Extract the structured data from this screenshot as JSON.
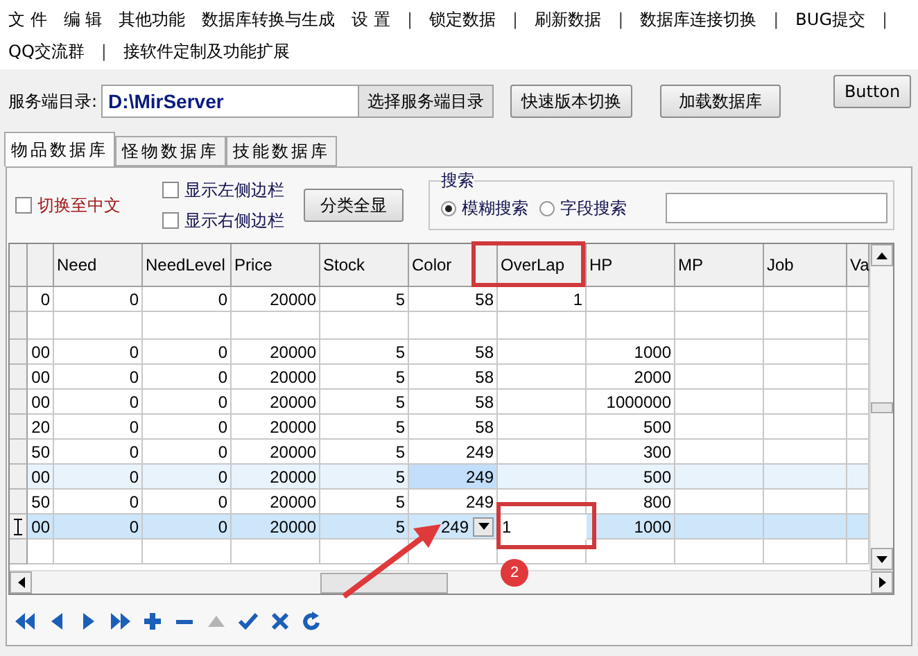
{
  "menu": [
    {
      "kind": "item",
      "label": "文 件"
    },
    {
      "kind": "item",
      "label": "编 辑"
    },
    {
      "kind": "item",
      "label": "其他功能"
    },
    {
      "kind": "item",
      "label": "数据库转换与生成"
    },
    {
      "kind": "item",
      "label": "设 置"
    },
    {
      "kind": "separator",
      "label": "|"
    },
    {
      "kind": "item",
      "label": "锁定数据"
    },
    {
      "kind": "separator",
      "label": "|"
    },
    {
      "kind": "item",
      "label": "刷新数据"
    },
    {
      "kind": "separator",
      "label": "|"
    },
    {
      "kind": "item",
      "label": "数据库连接切换"
    },
    {
      "kind": "separator",
      "label": "|"
    },
    {
      "kind": "item",
      "label": "BUG提交"
    },
    {
      "kind": "separator",
      "label": "|"
    },
    {
      "kind": "item",
      "label": "QQ交流群"
    },
    {
      "kind": "separator",
      "label": "|"
    },
    {
      "kind": "item",
      "label": "接软件定制及功能扩展"
    }
  ],
  "server_dir": {
    "label": "服务端目录:",
    "value": "D:\\MirServer",
    "browse_button": "选择服务端目录"
  },
  "buttons": [
    "快速版本切换",
    "加载数据库",
    "Button"
  ],
  "tabs": [
    {
      "label": "物品数据库",
      "selected": true
    },
    {
      "label": "怪物数据库",
      "selected": false
    },
    {
      "label": "技能数据库",
      "selected": false
    }
  ],
  "options": {
    "switch_language": {
      "label": "切换至中文",
      "checked": false
    },
    "show_left": {
      "label": "显示左侧边栏",
      "checked": false
    },
    "show_right": {
      "label": "显示右侧边栏",
      "checked": false
    },
    "show_all_button": "分类全显"
  },
  "search": {
    "title": "搜索",
    "modes": [
      {
        "label": "模糊搜索",
        "selected": true
      },
      {
        "label": "字段搜索",
        "selected": false
      }
    ]
  },
  "grid": {
    "columns": [
      "",
      "Need",
      "NeedLevel",
      "Price",
      "Stock",
      "Color",
      "OverLap",
      "HP",
      "MP",
      "Job",
      "Va"
    ],
    "rows": [
      {
        "selected": false,
        "highlighted": false,
        "cells": [
          "0",
          "0",
          "0",
          "20000",
          "5",
          "58",
          "1",
          "",
          "",
          "",
          ""
        ]
      },
      {
        "selected": false,
        "highlighted": false,
        "cells": [
          "",
          "",
          "",
          "",
          "",
          "",
          "",
          "",
          "",
          "",
          ""
        ]
      },
      {
        "selected": false,
        "highlighted": false,
        "cells": [
          "00",
          "0",
          "0",
          "20000",
          "5",
          "58",
          "",
          "1000",
          "",
          "",
          ""
        ]
      },
      {
        "selected": false,
        "highlighted": false,
        "cells": [
          "00",
          "0",
          "0",
          "20000",
          "5",
          "58",
          "",
          "2000",
          "",
          "",
          ""
        ]
      },
      {
        "selected": false,
        "highlighted": false,
        "cells": [
          "00",
          "0",
          "0",
          "20000",
          "5",
          "58",
          "",
          "1000000",
          "",
          "",
          ""
        ]
      },
      {
        "selected": false,
        "highlighted": false,
        "cells": [
          "20",
          "0",
          "0",
          "20000",
          "5",
          "58",
          "",
          "500",
          "",
          "",
          ""
        ]
      },
      {
        "selected": false,
        "highlighted": false,
        "cells": [
          "50",
          "0",
          "0",
          "20000",
          "5",
          "249",
          "",
          "300",
          "",
          "",
          ""
        ]
      },
      {
        "selected": false,
        "highlighted": true,
        "cells": [
          "00",
          "0",
          "0",
          "20000",
          "5",
          {
            "kind": "focused",
            "text": "249"
          },
          "",
          "500",
          "",
          "",
          ""
        ]
      },
      {
        "selected": false,
        "highlighted": false,
        "cells": [
          "50",
          "0",
          "0",
          "20000",
          "5",
          "249",
          "",
          "800",
          "",
          "",
          ""
        ]
      },
      {
        "selected": true,
        "highlighted": false,
        "cells": [
          "00",
          "0",
          "0",
          "20000",
          "5",
          {
            "kind": "dropdown",
            "text": "249"
          },
          {
            "kind": "input",
            "text": "1"
          },
          "1000",
          "",
          "",
          ""
        ]
      },
      {
        "selected": false,
        "highlighted": false,
        "cells": [
          "",
          "",
          "",
          "",
          "",
          "",
          "",
          "",
          "",
          "",
          ""
        ]
      }
    ]
  },
  "navigator": [
    {
      "kind": "first",
      "disabled": false
    },
    {
      "kind": "prior",
      "disabled": false
    },
    {
      "kind": "next",
      "disabled": false
    },
    {
      "kind": "last",
      "disabled": false
    },
    {
      "kind": "insert",
      "disabled": false
    },
    {
      "kind": "delete",
      "disabled": false
    },
    {
      "kind": "edit",
      "disabled": true
    },
    {
      "kind": "post",
      "disabled": false
    },
    {
      "kind": "cancel",
      "disabled": false
    },
    {
      "kind": "refresh",
      "disabled": false
    }
  ],
  "annotation": {
    "badge": "2"
  }
}
